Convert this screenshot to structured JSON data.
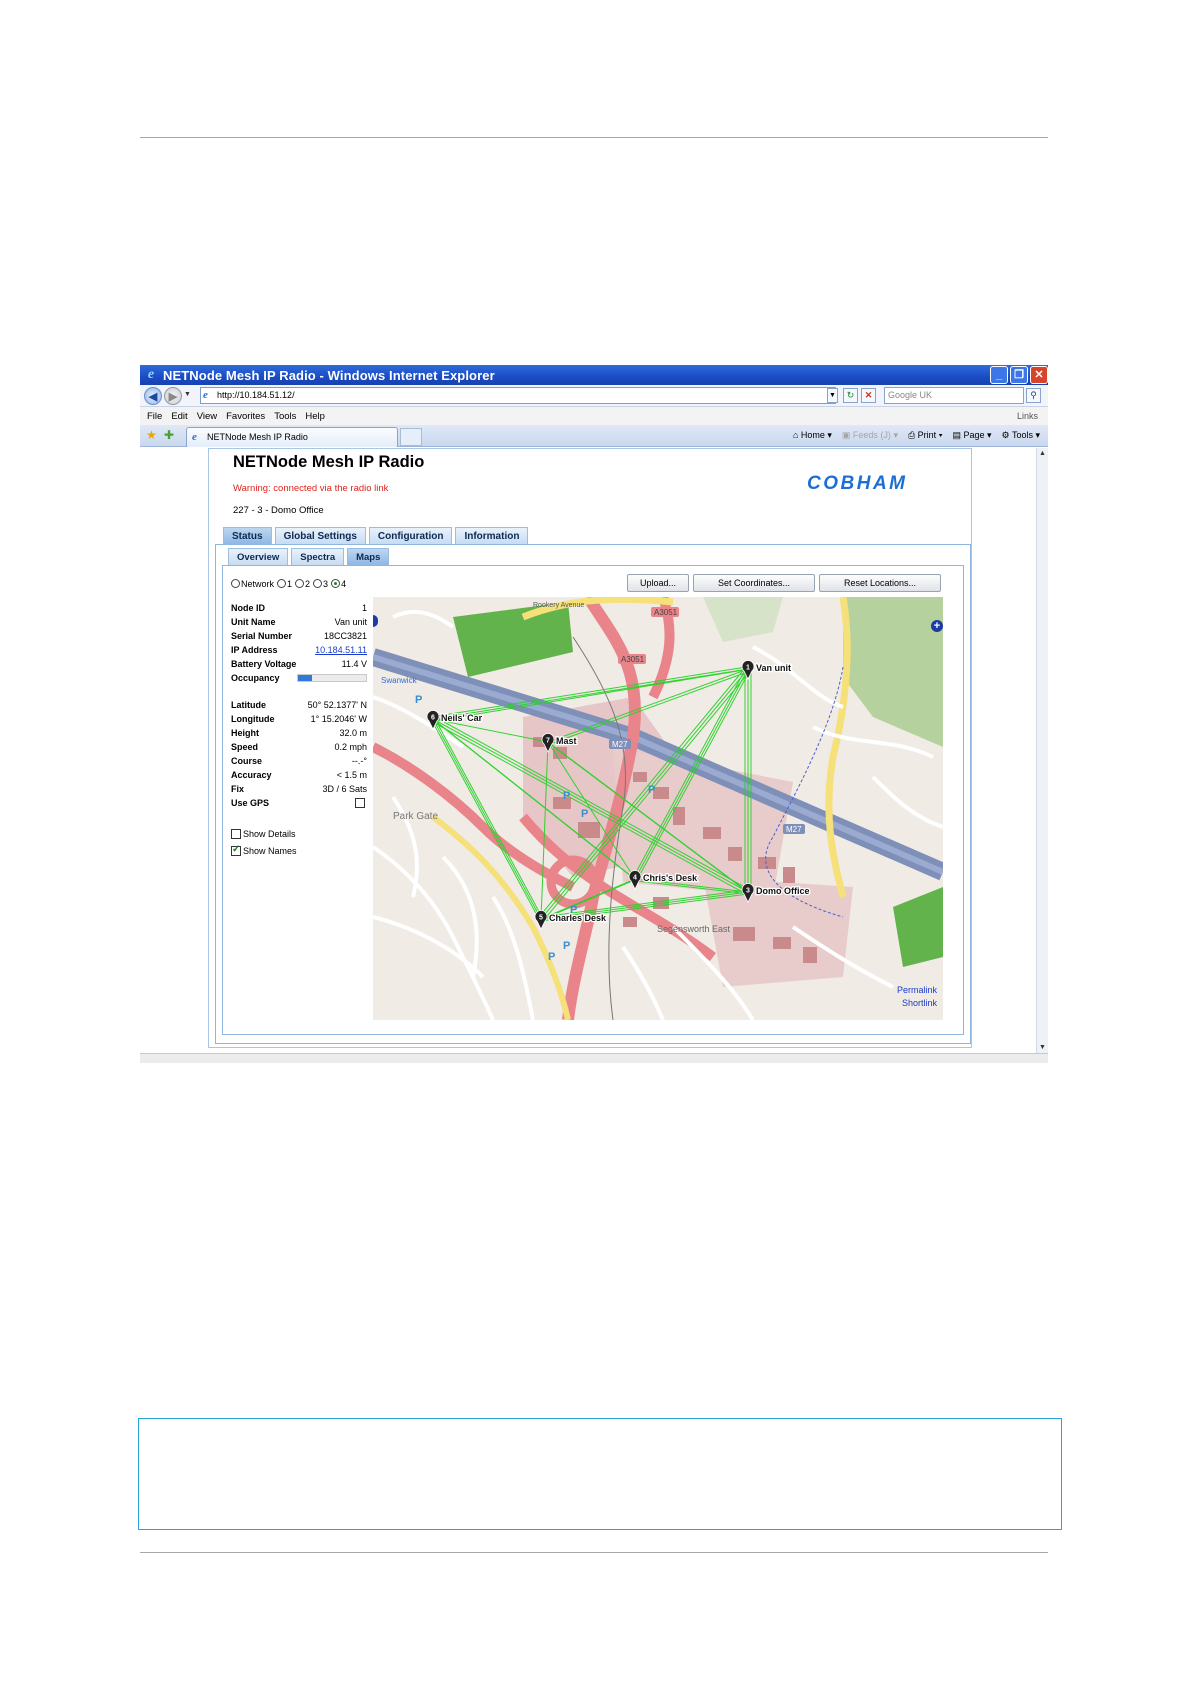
{
  "browser": {
    "window_title": "NETNode Mesh IP Radio - Windows Internet Explorer",
    "url": "http://10.184.51.12/",
    "search_placeholder": "Google UK",
    "menu": [
      "File",
      "Edit",
      "View",
      "Favorites",
      "Tools",
      "Help"
    ],
    "links_label": "Links",
    "tab_title": "NETNode Mesh IP Radio",
    "commands": {
      "home": "Home",
      "feeds": "Feeds (J)",
      "print": "Print",
      "page": "Page",
      "tools": "Tools"
    }
  },
  "app": {
    "title": "NETNode Mesh IP Radio",
    "warning": "Warning: connected via the radio link",
    "node_line": "227 - 3 - Domo Office",
    "brand": "COBHAM",
    "main_tabs": [
      "Status",
      "Global Settings",
      "Configuration",
      "Information"
    ],
    "sub_tabs": [
      "Overview",
      "Spectra",
      "Maps"
    ],
    "radio_options": [
      "Network",
      "1",
      "2",
      "3",
      "4"
    ],
    "radio_selected": "4",
    "buttons": {
      "upload": "Upload...",
      "set_coordinates": "Set Coordinates...",
      "reset_locations": "Reset Locations..."
    }
  },
  "node_info": {
    "node_id": {
      "label": "Node ID",
      "value": "1"
    },
    "unit_name": {
      "label": "Unit Name",
      "value": "Van unit"
    },
    "serial_number": {
      "label": "Serial Number",
      "value": "18CC3821"
    },
    "ip_address": {
      "label": "IP Address",
      "value": "10.184.51.11"
    },
    "battery_voltage": {
      "label": "Battery Voltage",
      "value": "11.4 V"
    },
    "occupancy": {
      "label": "Occupancy",
      "fraction": 0.2
    },
    "latitude": {
      "label": "Latitude",
      "value": "50° 52.1377' N"
    },
    "longitude": {
      "label": "Longitude",
      "value": "1° 15.2046' W"
    },
    "height": {
      "label": "Height",
      "value": "32.0 m"
    },
    "speed": {
      "label": "Speed",
      "value": "0.2 mph"
    },
    "course": {
      "label": "Course",
      "value": "--.-°"
    },
    "accuracy": {
      "label": "Accuracy",
      "value": "< 1.5 m"
    },
    "fix": {
      "label": "Fix",
      "value": "3D / 6 Sats"
    },
    "use_gps": {
      "label": "Use GPS",
      "checked": false
    },
    "show_details": {
      "label": "Show Details",
      "checked": false
    },
    "show_names": {
      "label": "Show Names",
      "checked": true
    }
  },
  "map": {
    "nodes": [
      {
        "id": "1",
        "name": "Van unit"
      },
      {
        "id": "6",
        "name": "Neils' Car"
      },
      {
        "id": "7",
        "name": "Mast"
      },
      {
        "id": "4",
        "name": "Chris's Desk"
      },
      {
        "id": "3",
        "name": "Domo Office"
      },
      {
        "id": "5",
        "name": "Charles Desk"
      }
    ],
    "labels": [
      "A3051",
      "A3051",
      "M27",
      "M27",
      "Swanwick",
      "Park Gate",
      "Segensworth East",
      "Rookery Avenue"
    ],
    "permalink": "Permalink",
    "shortlink": "Shortlink",
    "link_color": "#29d12b"
  }
}
